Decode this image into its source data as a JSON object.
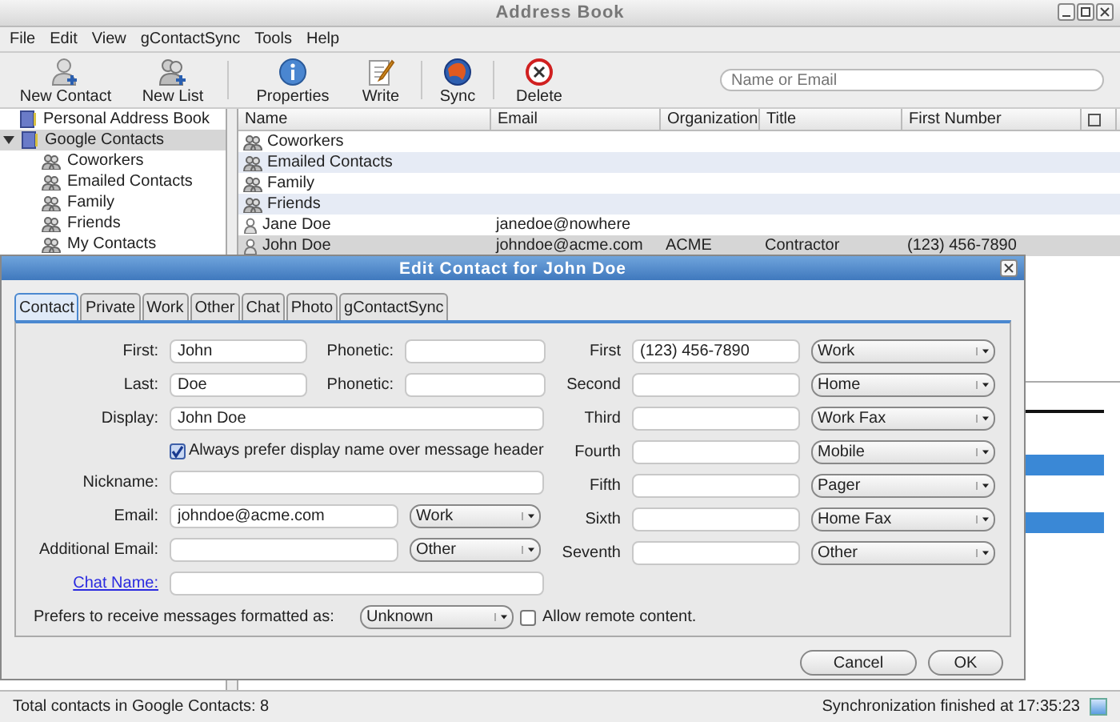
{
  "window": {
    "title": "Address Book"
  },
  "menu": [
    "File",
    "Edit",
    "View",
    "gContactSync",
    "Tools",
    "Help"
  ],
  "toolbar": {
    "buttons": [
      {
        "kind": "new-contact",
        "label": "New Contact"
      },
      {
        "kind": "new-list",
        "label": "New List"
      },
      {
        "kind": "properties",
        "label": "Properties"
      },
      {
        "kind": "write",
        "label": "Write"
      },
      {
        "kind": "sync",
        "label": "Sync"
      },
      {
        "kind": "delete",
        "label": "Delete"
      }
    ],
    "search": {
      "placeholder": "Name or Email"
    }
  },
  "sidebar": {
    "items": [
      {
        "label": "Personal Address Book",
        "selected": false
      },
      {
        "label": "Google Contacts",
        "selected": true,
        "expanded": true,
        "children": [
          {
            "label": "Coworkers",
            "selected": false
          },
          {
            "label": "Emailed Contacts",
            "selected": false
          },
          {
            "label": "Family",
            "selected": false
          },
          {
            "label": "Friends",
            "selected": false
          },
          {
            "label": "My Contacts",
            "selected": false
          }
        ]
      }
    ]
  },
  "table": {
    "columns": [
      "Name",
      "Email",
      "Organization",
      "Title",
      "First Number"
    ],
    "rows": [
      {
        "kind": "list",
        "name": "Coworkers",
        "selected": false
      },
      {
        "kind": "list",
        "name": "Emailed Contacts",
        "selected": false
      },
      {
        "kind": "list",
        "name": "Family",
        "selected": false
      },
      {
        "kind": "list",
        "name": "Friends",
        "selected": false
      },
      {
        "kind": "contact",
        "name": "Jane Doe",
        "email": "janedoe@nowhere",
        "selected": false
      },
      {
        "kind": "contact",
        "name": "John Doe",
        "email": "johndoe@acme.com",
        "organization": "ACME",
        "title": "Contractor",
        "first_number": "(123) 456-7890",
        "selected": true
      }
    ]
  },
  "status_bar": {
    "left": "Total contacts in Google Contacts: 8",
    "right": "Synchronization finished at 17:35:23"
  },
  "dialog": {
    "title": "Edit Contact for John Doe",
    "tabs": [
      {
        "label": "Contact",
        "selected": true
      },
      {
        "label": "Private",
        "selected": false
      },
      {
        "label": "Work",
        "selected": false
      },
      {
        "label": "Other",
        "selected": false
      },
      {
        "label": "Chat",
        "selected": false
      },
      {
        "label": "Photo",
        "selected": false
      },
      {
        "label": "gContactSync",
        "selected": false
      }
    ],
    "names": [
      {
        "label": "First:",
        "value": "John",
        "phonetic_label": "Phonetic:"
      },
      {
        "label": "Last:",
        "value": "Doe",
        "phonetic_label": "Phonetic:"
      }
    ],
    "display": {
      "label": "Display:",
      "value": "John Doe"
    },
    "prefer_display": {
      "label": "Always prefer display name over message header",
      "checked": true
    },
    "nickname": {
      "label": "Nickname:"
    },
    "emails": [
      {
        "label": "Email:",
        "value": "johndoe@acme.com",
        "type": "Work"
      },
      {
        "label": "Additional Email:",
        "type": "Other"
      }
    ],
    "chat_name": {
      "label": "Chat Name:"
    },
    "phones": [
      {
        "label": "First",
        "value": "(123) 456-7890",
        "type": "Work"
      },
      {
        "label": "Second",
        "type": "Home"
      },
      {
        "label": "Third",
        "type": "Work Fax"
      },
      {
        "label": "Fourth",
        "type": "Mobile"
      },
      {
        "label": "Fifth",
        "type": "Pager"
      },
      {
        "label": "Sixth",
        "type": "Home Fax"
      },
      {
        "label": "Seventh",
        "type": "Other"
      }
    ],
    "format": {
      "label": "Prefers to receive messages formatted as:",
      "value": "Unknown"
    },
    "remote_content": {
      "label": "Allow remote content.",
      "checked": false
    },
    "buttons": [
      "Cancel",
      "OK"
    ]
  }
}
